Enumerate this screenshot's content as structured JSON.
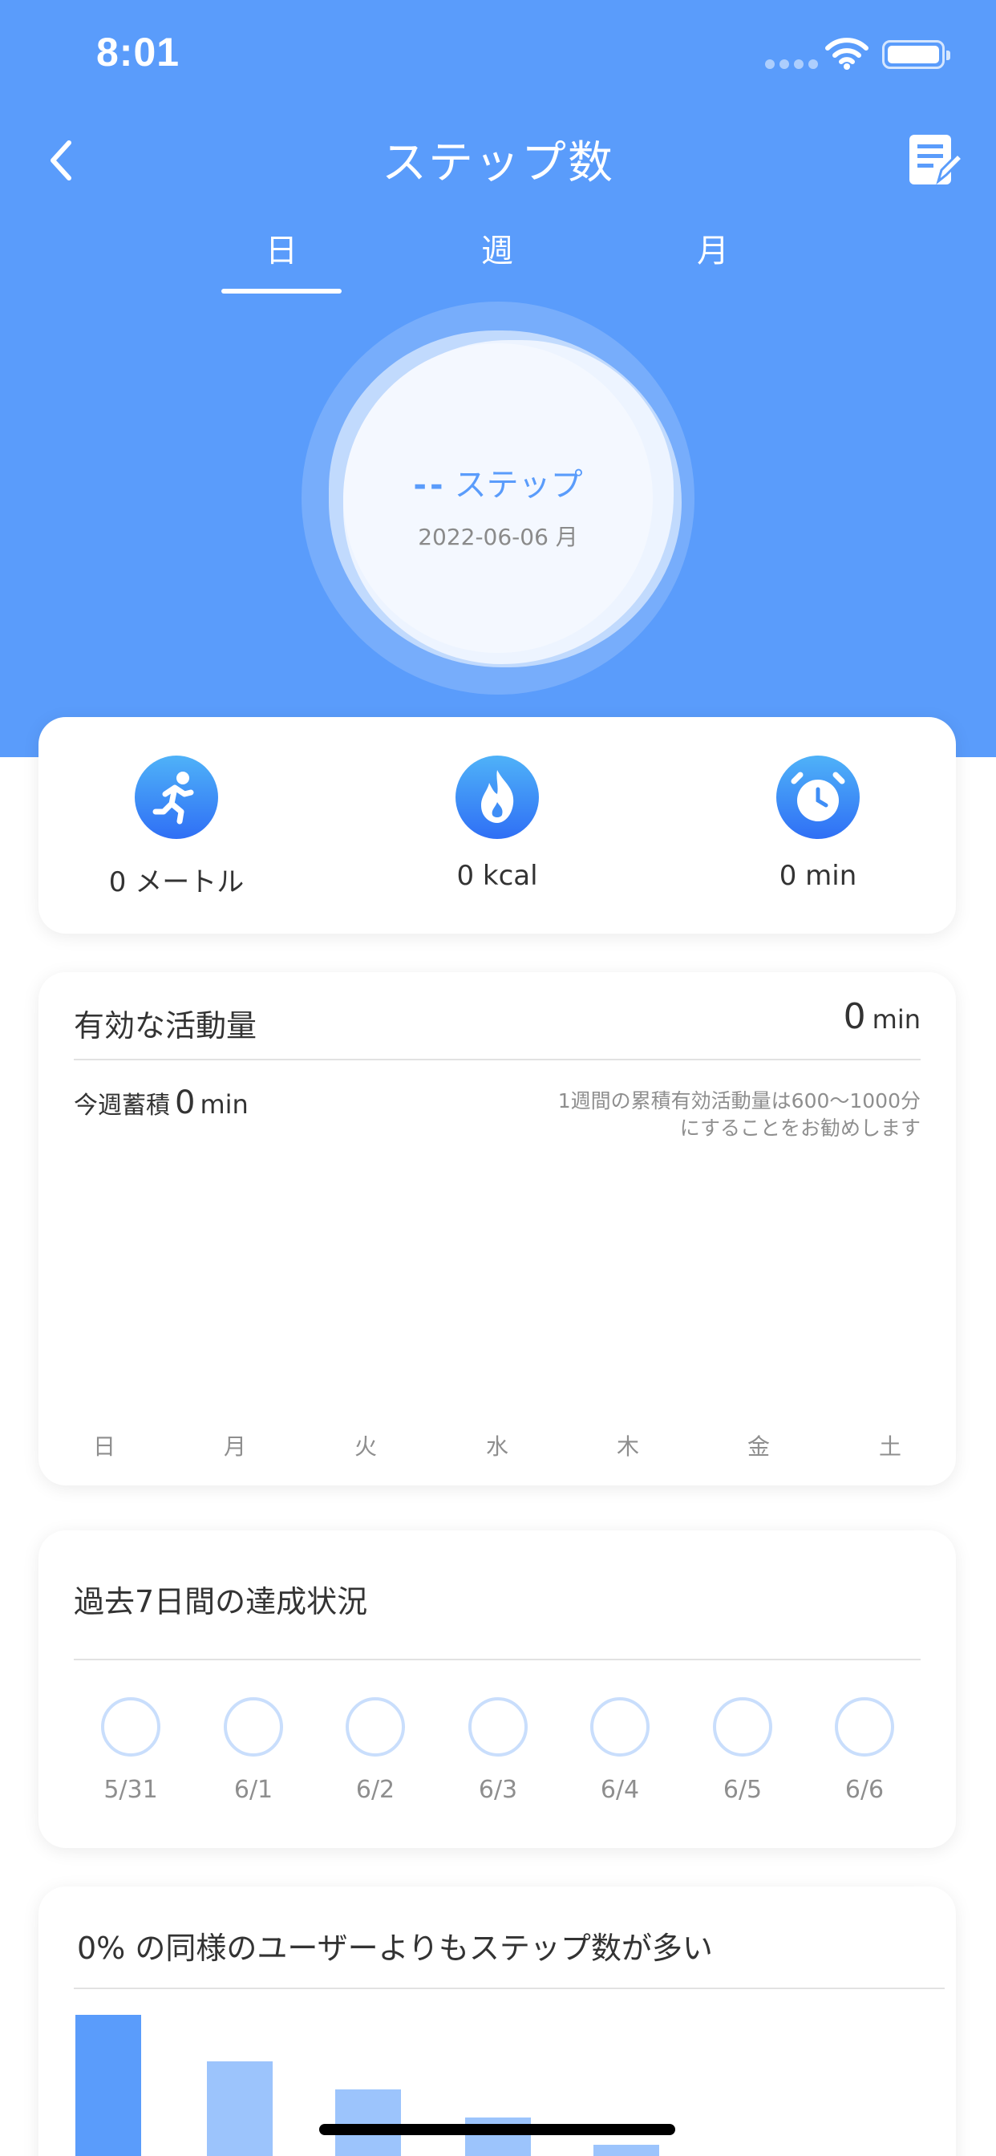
{
  "status_bar": {
    "time": "8:01"
  },
  "nav": {
    "title": "ステップ数",
    "back_icon": "chevron-left-icon",
    "edit_icon": "edit-note-icon"
  },
  "tabs": [
    {
      "label": "日",
      "active": true
    },
    {
      "label": "週",
      "active": false
    },
    {
      "label": "月",
      "active": false
    }
  ],
  "ring": {
    "steps_value": "--",
    "steps_unit": "ステップ",
    "date": "2022-06-06 月"
  },
  "stats": [
    {
      "icon": "running-icon",
      "label": "0 メートル"
    },
    {
      "icon": "flame-icon",
      "label": "0 kcal"
    },
    {
      "icon": "alarm-clock-icon",
      "label": "0 min"
    }
  ],
  "activity": {
    "title": "有効な活動量",
    "value": "0",
    "unit": "min",
    "week_prefix": "今週蓄積",
    "week_value": "0",
    "week_unit": "min",
    "advice_line1": "1週間の累積有効活動量は600～1000分",
    "advice_line2": "にすることをお勧めします",
    "weekdays": [
      "日",
      "月",
      "火",
      "水",
      "木",
      "金",
      "土"
    ]
  },
  "achievement": {
    "title": "過去7日間の達成状況",
    "days": [
      "5/31",
      "6/1",
      "6/2",
      "6/3",
      "6/4",
      "6/5",
      "6/6"
    ]
  },
  "comparison": {
    "title": "0% の同様のユーザーよりもステップ数が多い",
    "bar_colors": [
      "#5a9cfb",
      "#9cc4fc",
      "#9cc4fc",
      "#9cc4fc",
      "#9cc4fc"
    ],
    "bar_levels": [
      1.0,
      0.8,
      0.68,
      0.56,
      0.44
    ]
  },
  "colors": {
    "primary": "#5a9cfb",
    "light": "#9cc4fc",
    "circle": "#c9defc"
  }
}
